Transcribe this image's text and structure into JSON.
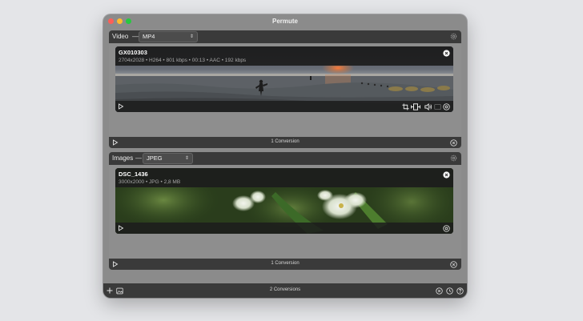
{
  "window": {
    "title": "Permute"
  },
  "video_section": {
    "label": "Video",
    "dash": "—",
    "format": "MP4",
    "card": {
      "name": "GX010303",
      "meta": "2704x2028 • H264 • 801 kbps • 00:13 • AAC • 192 kbps"
    },
    "footer": {
      "count": "1 Conversion"
    }
  },
  "images_section": {
    "label": "Images",
    "dash": "—",
    "format": "JPEG",
    "card": {
      "name": "DSC_1436",
      "meta": "3000x2000 • JPG • 2,8 MB"
    },
    "footer": {
      "count": "1 Conversion"
    }
  },
  "bottom_bar": {
    "count": "2 Conversions"
  },
  "icons": {
    "select_arrows": "⇕",
    "play": "play-icon",
    "close": "close-circle-icon",
    "gear": "gear-icon",
    "crop": "crop-icon",
    "trim": "trim-icon",
    "volume": "volume-icon",
    "subtitle": "subtitle-icon",
    "settings": "settings-circle-icon",
    "add": "plus-icon",
    "image": "image-icon",
    "history": "history-icon",
    "help": "help-icon"
  },
  "colors": {
    "window_bg": "#8b8b8b",
    "bar_bg": "#3a3a3a",
    "traffic_red": "#fe5f57",
    "traffic_yellow": "#febc2e",
    "traffic_green": "#28c840"
  }
}
